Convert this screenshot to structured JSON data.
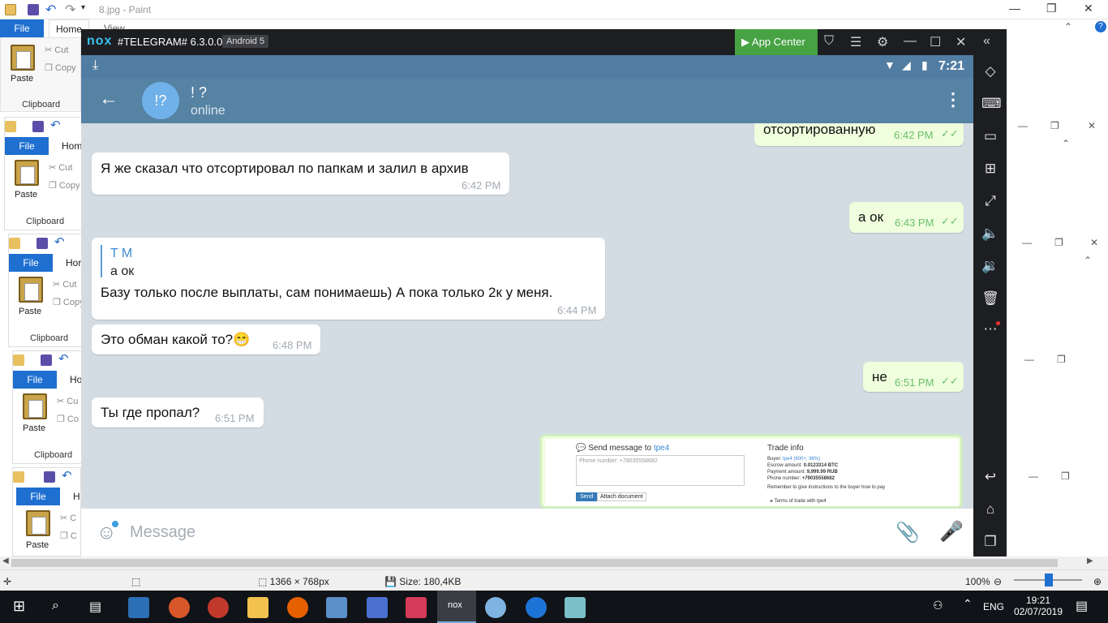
{
  "paint": {
    "title": "8.jpg - Paint",
    "file_tab": "File",
    "home_tab": "Home",
    "view_tab": "View",
    "paste": "Paste",
    "cut": "Cut",
    "copy": "Copy",
    "clipboard": "Clipboard",
    "status_dims": "1366 × 768px",
    "status_size": "Size: 180,4KB",
    "zoom": "100%",
    "partial_home": [
      "Hom",
      "Hor",
      "Ho",
      "H"
    ],
    "partial_cut": "Cu",
    "partial_copy": "Co",
    "partial_cut_short": "C"
  },
  "nox": {
    "logo": "nox",
    "app_title": "#TELEGRAM# 6.3.0.0",
    "android": "Android 5",
    "app_center": "App Center"
  },
  "phone": {
    "time": "7:21"
  },
  "chat": {
    "avatar": "!?",
    "title": "! ?",
    "status": "online",
    "input_placeholder": "Message"
  },
  "messages": [
    {
      "dir": "out",
      "text": "отсортированную",
      "time": "6:42 PM"
    },
    {
      "dir": "in",
      "text": "Я же сказал что отсортировал по папкам и залил в архив",
      "time": "6:42 PM"
    },
    {
      "dir": "out",
      "text": "а ок",
      "time": "6:43 PM"
    },
    {
      "dir": "in",
      "reply_name": "T M",
      "reply_text": "а ок",
      "text": "Базу только после выплаты, сам понимаешь) А пока только 2к у меня.",
      "time": "6:44 PM"
    },
    {
      "dir": "in",
      "text": "Это обман какой то?😁",
      "time": "6:48 PM"
    },
    {
      "dir": "out",
      "text": "не",
      "time": "6:51 PM"
    },
    {
      "dir": "in",
      "text": "Ты где пропал?",
      "time": "6:51 PM"
    }
  ],
  "preview": {
    "send_title": "Send message to",
    "send_user": "tpe4",
    "phone_ph": "Phone number: +79035558682",
    "send_btn": "Send",
    "attach_btn": "Attach document",
    "trade_title": "Trade info",
    "buyer": "Buyer:",
    "buyer_val": "tpe4 (600+; 96%)",
    "escrow": "Escrow amount:",
    "escrow_val": "0.0123314 BTC",
    "payment": "Payment amount:",
    "payment_val": "9,999.99 RUB",
    "phone_lbl": "Phone number:",
    "phone_val": "+79035558682",
    "remember": "Remember to give instructions to the buyer how to pay",
    "terms": "Terms of trade with tpe4"
  },
  "taskbar": {
    "lang": "ENG",
    "time": "19:21",
    "date": "02/07/2019"
  },
  "colors": {
    "telegram_header": "#5682a3",
    "outgoing_bubble": "#effedd",
    "app_center": "#47a244",
    "file_tab": "#1e6fd0"
  }
}
